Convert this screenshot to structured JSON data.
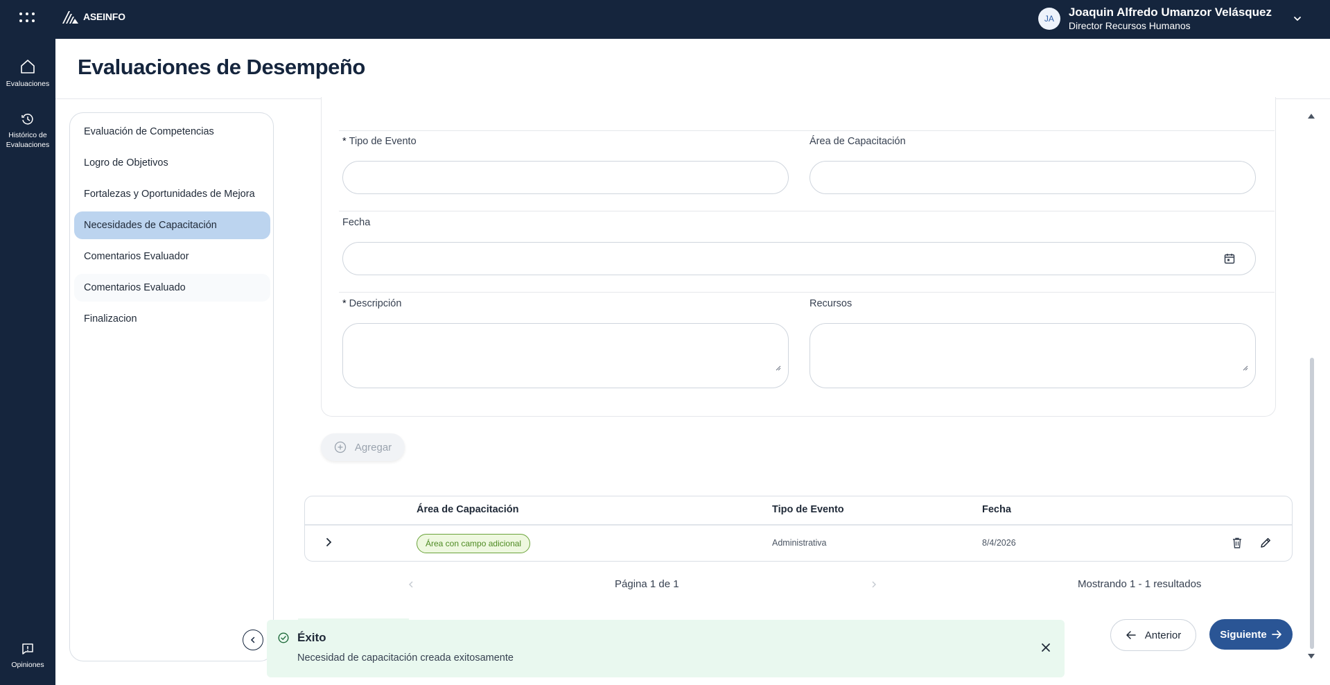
{
  "app": {
    "logo_text": "ASEINFO"
  },
  "user": {
    "initials": "JA",
    "name": "Joaquin Alfredo Umanzor Velásquez",
    "role": "Director Recursos Humanos"
  },
  "rail": {
    "items": [
      {
        "label": "Evaluaciones",
        "icon": "home-icon"
      },
      {
        "label": "Histórico de Evaluaciones",
        "icon": "history-icon"
      }
    ],
    "bottom": {
      "label": "Opiniones",
      "icon": "feedback-icon"
    }
  },
  "page": {
    "title": "Evaluaciones de Desempeño"
  },
  "sections": {
    "items": [
      {
        "label": "Evaluación de Competencias"
      },
      {
        "label": "Logro de Objetivos"
      },
      {
        "label": "Fortalezas y Oportunidades de Mejora"
      },
      {
        "label": "Necesidades de Capacitación",
        "active": true
      },
      {
        "label": "Comentarios Evaluador"
      },
      {
        "label": "Comentarios Evaluado"
      },
      {
        "label": "Finalizacion"
      }
    ]
  },
  "form": {
    "required_mark": "*",
    "tipo_evento_label": "Tipo de Evento",
    "tipo_evento_value": "",
    "area_label": "Área de Capacitación",
    "area_value": "",
    "fecha_label": "Fecha",
    "fecha_value": "",
    "descripcion_label": "Descripción",
    "descripcion_value": "",
    "recursos_label": "Recursos",
    "recursos_value": "",
    "add_label": "Agregar"
  },
  "table": {
    "columns": [
      "Área de Capacitación",
      "Tipo de Evento",
      "Fecha"
    ],
    "rows": [
      {
        "area": "Área con campo adicional",
        "tipo": "Administrativa",
        "fecha": "8/4/2026"
      }
    ]
  },
  "pagination": {
    "page_text": "Página 1 de 1",
    "results_text": "Mostrando 1 - 1 resultados"
  },
  "nav": {
    "prev_label": "Anterior",
    "next_label": "Siguiente"
  },
  "toast": {
    "title": "Éxito",
    "message": "Necesidad de capacitación creada exitosamente"
  },
  "colors": {
    "header_bg": "#15253d",
    "active_section": "#bcd4ef",
    "primary_button": "#2a5595",
    "tag_border": "#6aa33a",
    "toast_bg": "#e9f8ef"
  }
}
